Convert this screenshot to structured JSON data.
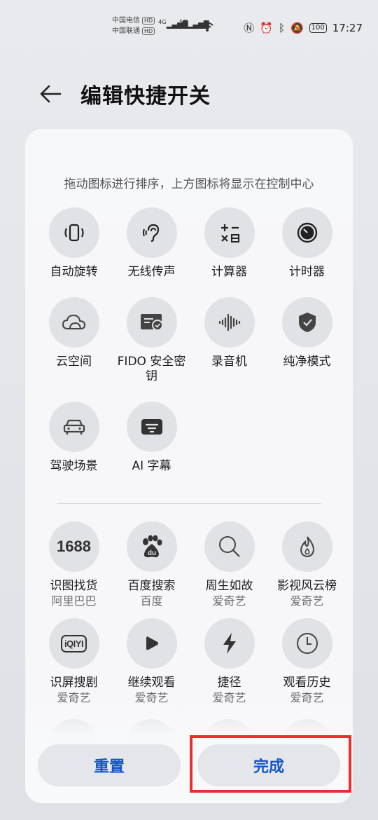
{
  "status_bar": {
    "carrier1": "中国电信",
    "carrier2": "中国联通",
    "hd": "HD",
    "net1": "4G",
    "net2": "5G",
    "battery": "100",
    "time": "17:27"
  },
  "header": {
    "title": "编辑快捷开关"
  },
  "hint": "拖动图标进行排序，上方图标将显示在控制中心",
  "active_tiles": [
    {
      "label": "自动旋转",
      "icon": "auto-rotate-icon"
    },
    {
      "label": "无线传声",
      "icon": "ear-icon"
    },
    {
      "label": "计算器",
      "icon": "calculator-icon"
    },
    {
      "label": "计时器",
      "icon": "timer-icon"
    },
    {
      "label": "云空间",
      "icon": "cloud-icon"
    },
    {
      "label": "FIDO 安全密钥",
      "icon": "security-card-icon"
    },
    {
      "label": "录音机",
      "icon": "soundwave-icon"
    },
    {
      "label": "纯净模式",
      "icon": "shield-check-icon"
    },
    {
      "label": "驾驶场景",
      "icon": "car-icon"
    },
    {
      "label": "AI 字幕",
      "icon": "subtitle-icon"
    }
  ],
  "app_tiles": [
    {
      "label": "识图找货",
      "sub": "阿里巴巴",
      "icon": "1688-icon",
      "icon_text": "1688"
    },
    {
      "label": "百度搜索",
      "sub": "百度",
      "icon": "baidu-paw-icon",
      "icon_text": "du"
    },
    {
      "label": "周生如故",
      "sub": "爱奇艺",
      "icon": "search-icon"
    },
    {
      "label": "影视风云榜",
      "sub": "爱奇艺",
      "icon": "flame-icon"
    },
    {
      "label": "识屏搜剧",
      "sub": "爱奇艺",
      "icon": "iqiyi-icon",
      "icon_text": "iQIYI"
    },
    {
      "label": "继续观看",
      "sub": "爱奇艺",
      "icon": "play-icon"
    },
    {
      "label": "捷径",
      "sub": "爱奇艺",
      "icon": "lightning-icon"
    },
    {
      "label": "观看历史",
      "sub": "爱奇艺",
      "icon": "clock-icon"
    }
  ],
  "buttons": {
    "reset": "重置",
    "done": "完成"
  },
  "colors": {
    "accent": "#1456c7",
    "highlight": "#ef2d2d",
    "tile_bg": "#e1e2e6"
  }
}
